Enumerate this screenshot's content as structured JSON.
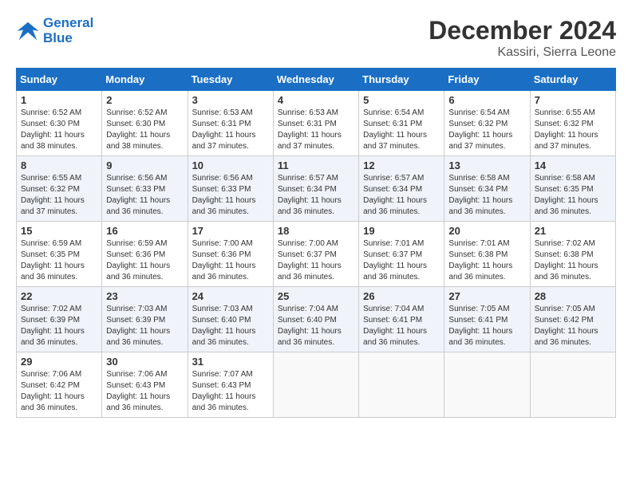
{
  "header": {
    "logo_line1": "General",
    "logo_line2": "Blue",
    "month_year": "December 2024",
    "location": "Kassiri, Sierra Leone"
  },
  "weekdays": [
    "Sunday",
    "Monday",
    "Tuesday",
    "Wednesday",
    "Thursday",
    "Friday",
    "Saturday"
  ],
  "weeks": [
    [
      {
        "day": "1",
        "sunrise": "6:52 AM",
        "sunset": "6:30 PM",
        "daylight": "11 hours and 38 minutes."
      },
      {
        "day": "2",
        "sunrise": "6:52 AM",
        "sunset": "6:30 PM",
        "daylight": "11 hours and 38 minutes."
      },
      {
        "day": "3",
        "sunrise": "6:53 AM",
        "sunset": "6:31 PM",
        "daylight": "11 hours and 37 minutes."
      },
      {
        "day": "4",
        "sunrise": "6:53 AM",
        "sunset": "6:31 PM",
        "daylight": "11 hours and 37 minutes."
      },
      {
        "day": "5",
        "sunrise": "6:54 AM",
        "sunset": "6:31 PM",
        "daylight": "11 hours and 37 minutes."
      },
      {
        "day": "6",
        "sunrise": "6:54 AM",
        "sunset": "6:32 PM",
        "daylight": "11 hours and 37 minutes."
      },
      {
        "day": "7",
        "sunrise": "6:55 AM",
        "sunset": "6:32 PM",
        "daylight": "11 hours and 37 minutes."
      }
    ],
    [
      {
        "day": "8",
        "sunrise": "6:55 AM",
        "sunset": "6:32 PM",
        "daylight": "11 hours and 37 minutes."
      },
      {
        "day": "9",
        "sunrise": "6:56 AM",
        "sunset": "6:33 PM",
        "daylight": "11 hours and 36 minutes."
      },
      {
        "day": "10",
        "sunrise": "6:56 AM",
        "sunset": "6:33 PM",
        "daylight": "11 hours and 36 minutes."
      },
      {
        "day": "11",
        "sunrise": "6:57 AM",
        "sunset": "6:34 PM",
        "daylight": "11 hours and 36 minutes."
      },
      {
        "day": "12",
        "sunrise": "6:57 AM",
        "sunset": "6:34 PM",
        "daylight": "11 hours and 36 minutes."
      },
      {
        "day": "13",
        "sunrise": "6:58 AM",
        "sunset": "6:34 PM",
        "daylight": "11 hours and 36 minutes."
      },
      {
        "day": "14",
        "sunrise": "6:58 AM",
        "sunset": "6:35 PM",
        "daylight": "11 hours and 36 minutes."
      }
    ],
    [
      {
        "day": "15",
        "sunrise": "6:59 AM",
        "sunset": "6:35 PM",
        "daylight": "11 hours and 36 minutes."
      },
      {
        "day": "16",
        "sunrise": "6:59 AM",
        "sunset": "6:36 PM",
        "daylight": "11 hours and 36 minutes."
      },
      {
        "day": "17",
        "sunrise": "7:00 AM",
        "sunset": "6:36 PM",
        "daylight": "11 hours and 36 minutes."
      },
      {
        "day": "18",
        "sunrise": "7:00 AM",
        "sunset": "6:37 PM",
        "daylight": "11 hours and 36 minutes."
      },
      {
        "day": "19",
        "sunrise": "7:01 AM",
        "sunset": "6:37 PM",
        "daylight": "11 hours and 36 minutes."
      },
      {
        "day": "20",
        "sunrise": "7:01 AM",
        "sunset": "6:38 PM",
        "daylight": "11 hours and 36 minutes."
      },
      {
        "day": "21",
        "sunrise": "7:02 AM",
        "sunset": "6:38 PM",
        "daylight": "11 hours and 36 minutes."
      }
    ],
    [
      {
        "day": "22",
        "sunrise": "7:02 AM",
        "sunset": "6:39 PM",
        "daylight": "11 hours and 36 minutes."
      },
      {
        "day": "23",
        "sunrise": "7:03 AM",
        "sunset": "6:39 PM",
        "daylight": "11 hours and 36 minutes."
      },
      {
        "day": "24",
        "sunrise": "7:03 AM",
        "sunset": "6:40 PM",
        "daylight": "11 hours and 36 minutes."
      },
      {
        "day": "25",
        "sunrise": "7:04 AM",
        "sunset": "6:40 PM",
        "daylight": "11 hours and 36 minutes."
      },
      {
        "day": "26",
        "sunrise": "7:04 AM",
        "sunset": "6:41 PM",
        "daylight": "11 hours and 36 minutes."
      },
      {
        "day": "27",
        "sunrise": "7:05 AM",
        "sunset": "6:41 PM",
        "daylight": "11 hours and 36 minutes."
      },
      {
        "day": "28",
        "sunrise": "7:05 AM",
        "sunset": "6:42 PM",
        "daylight": "11 hours and 36 minutes."
      }
    ],
    [
      {
        "day": "29",
        "sunrise": "7:06 AM",
        "sunset": "6:42 PM",
        "daylight": "11 hours and 36 minutes."
      },
      {
        "day": "30",
        "sunrise": "7:06 AM",
        "sunset": "6:43 PM",
        "daylight": "11 hours and 36 minutes."
      },
      {
        "day": "31",
        "sunrise": "7:07 AM",
        "sunset": "6:43 PM",
        "daylight": "11 hours and 36 minutes."
      },
      null,
      null,
      null,
      null
    ]
  ]
}
